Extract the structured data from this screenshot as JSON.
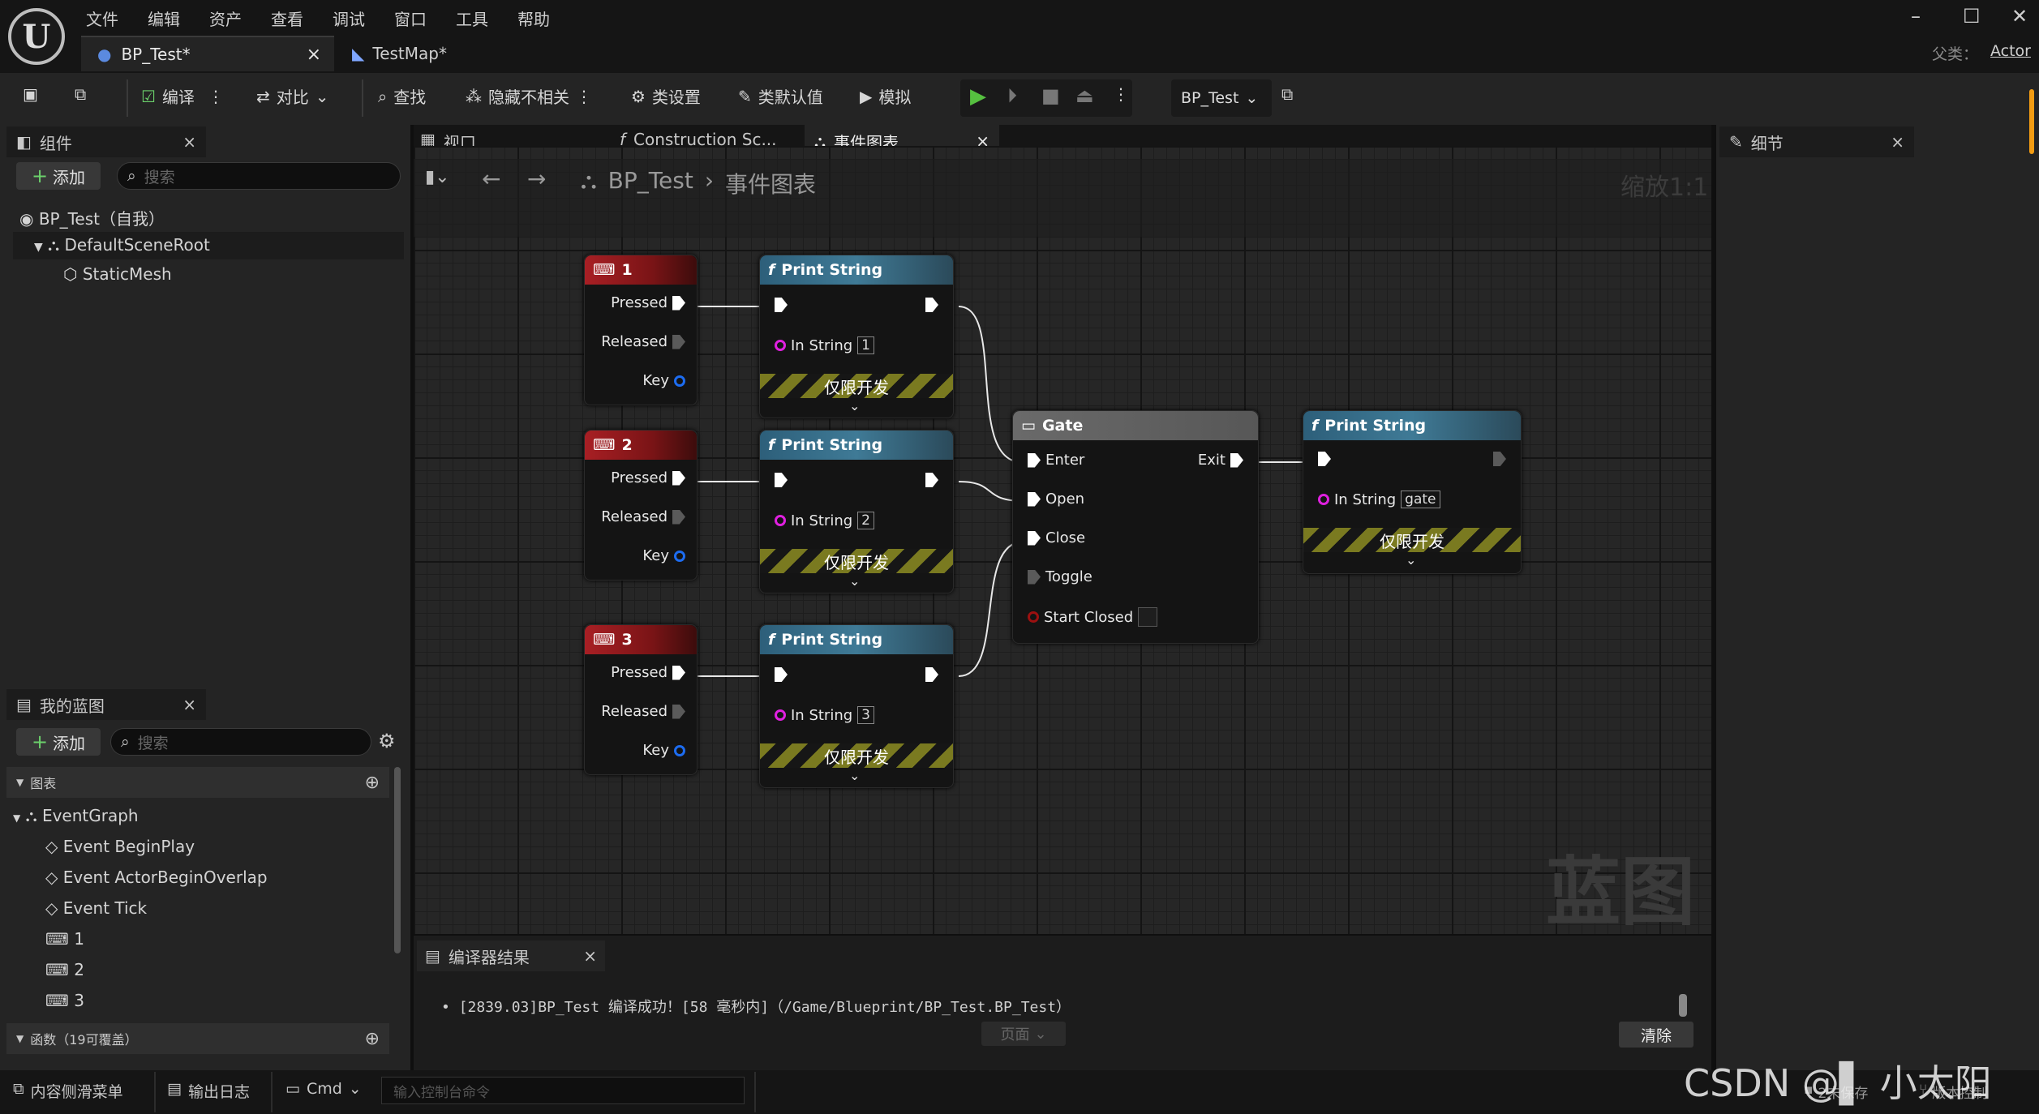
{
  "menu": [
    "文件",
    "编辑",
    "资产",
    "查看",
    "调试",
    "窗口",
    "工具",
    "帮助"
  ],
  "tabs": [
    {
      "label": "BP_Test*"
    },
    {
      "label": "TestMap*"
    }
  ],
  "parent_class": {
    "label": "父类：",
    "value": "Actor"
  },
  "toolbar": {
    "compile": "编译",
    "diff": "对比",
    "find": "查找",
    "hide_unrelated": "隐藏不相关",
    "class_settings": "类设置",
    "class_defaults": "类默认值",
    "simulate": "模拟",
    "debug_object": "BP_Test"
  },
  "components": {
    "title": "组件",
    "add": "添加",
    "search_placeholder": "搜索",
    "items": [
      "BP_Test（自我）",
      "DefaultSceneRoot",
      "StaticMesh"
    ]
  },
  "my_blueprint": {
    "title": "我的蓝图",
    "add": "添加",
    "search_placeholder": "搜索",
    "graphs_label": "图表",
    "event_graph": "EventGraph",
    "events": [
      "Event BeginPlay",
      "Event ActorBeginOverlap",
      "Event Tick",
      "1",
      "2",
      "3"
    ],
    "functions_label": "函数（19可覆盖）"
  },
  "editor_tabs": [
    "视口",
    "Construction Sc...",
    "事件图表"
  ],
  "breadcrumb": {
    "root": "BP_Test",
    "current": "事件图表",
    "zoom": "缩放1:1"
  },
  "details": {
    "title": "细节"
  },
  "watermark": "蓝图",
  "nodes": {
    "key1": {
      "title": "1"
    },
    "key2": {
      "title": "2"
    },
    "key3": {
      "title": "3"
    },
    "pressed": "Pressed",
    "released": "Released",
    "key": "Key",
    "print_title": "Print String",
    "in_string": "In String",
    "dev_only": "仅限开发",
    "print_values": [
      "1",
      "2",
      "3",
      "gate"
    ],
    "gate": {
      "title": "Gate",
      "enter": "Enter",
      "open": "Open",
      "close": "Close",
      "toggle": "Toggle",
      "start_closed": "Start Closed",
      "exit": "Exit"
    }
  },
  "compiler": {
    "title": "编译器结果",
    "message": "[2839.03]BP_Test 编译成功！[58 毫秒内]（/Game/Blueprint/BP_Test.BP_Test）",
    "page": "页面",
    "clear": "清除"
  },
  "status": {
    "content_drawer": "内容侧滑菜单",
    "output_log": "输出日志",
    "cmd": "Cmd",
    "console_placeholder": "输入控制台命令",
    "unsaved": "2未保存",
    "source_control": "版本控制"
  },
  "credit": "CSDN @▌ 小太阳"
}
